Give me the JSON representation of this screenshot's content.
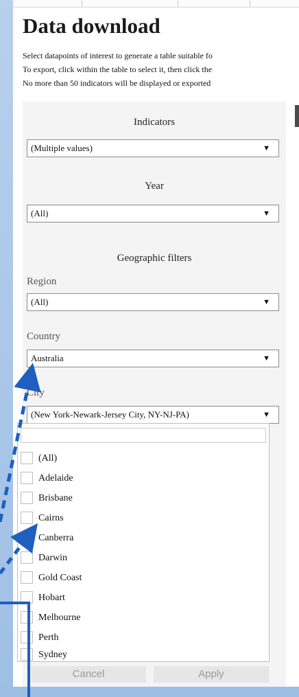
{
  "page": {
    "title": "Data download",
    "description_lines": [
      "Select datapoints of interest to generate a table suitable fo",
      "To export, click within the table to select it, then click the",
      "No more than 50 indicators will be displayed or exported"
    ]
  },
  "filters": {
    "indicators": {
      "label": "Indicators",
      "value": "(Multiple values)"
    },
    "year": {
      "label": "Year",
      "value": "(All)"
    },
    "geographic_heading": "Geographic filters",
    "region": {
      "label": "Region",
      "value": "(All)"
    },
    "country": {
      "label": "Country",
      "value": "Australia"
    },
    "city": {
      "label": "City",
      "value": "(New York-Newark-Jersey City, NY-NJ-PA)",
      "options": [
        "(All)",
        "Adelaide",
        "Brisbane",
        "Cairns",
        "Canberra",
        "Darwin",
        "Gold Coast",
        "Hobart",
        "Melbourne",
        "Perth",
        "Sydney"
      ]
    }
  },
  "dropdown_buttons": {
    "cancel": "Cancel",
    "apply": "Apply"
  },
  "colors": {
    "arrow": "#1f5fbf",
    "background": "#a9c6e6"
  },
  "icons": {
    "caret": "caret-down-icon"
  }
}
